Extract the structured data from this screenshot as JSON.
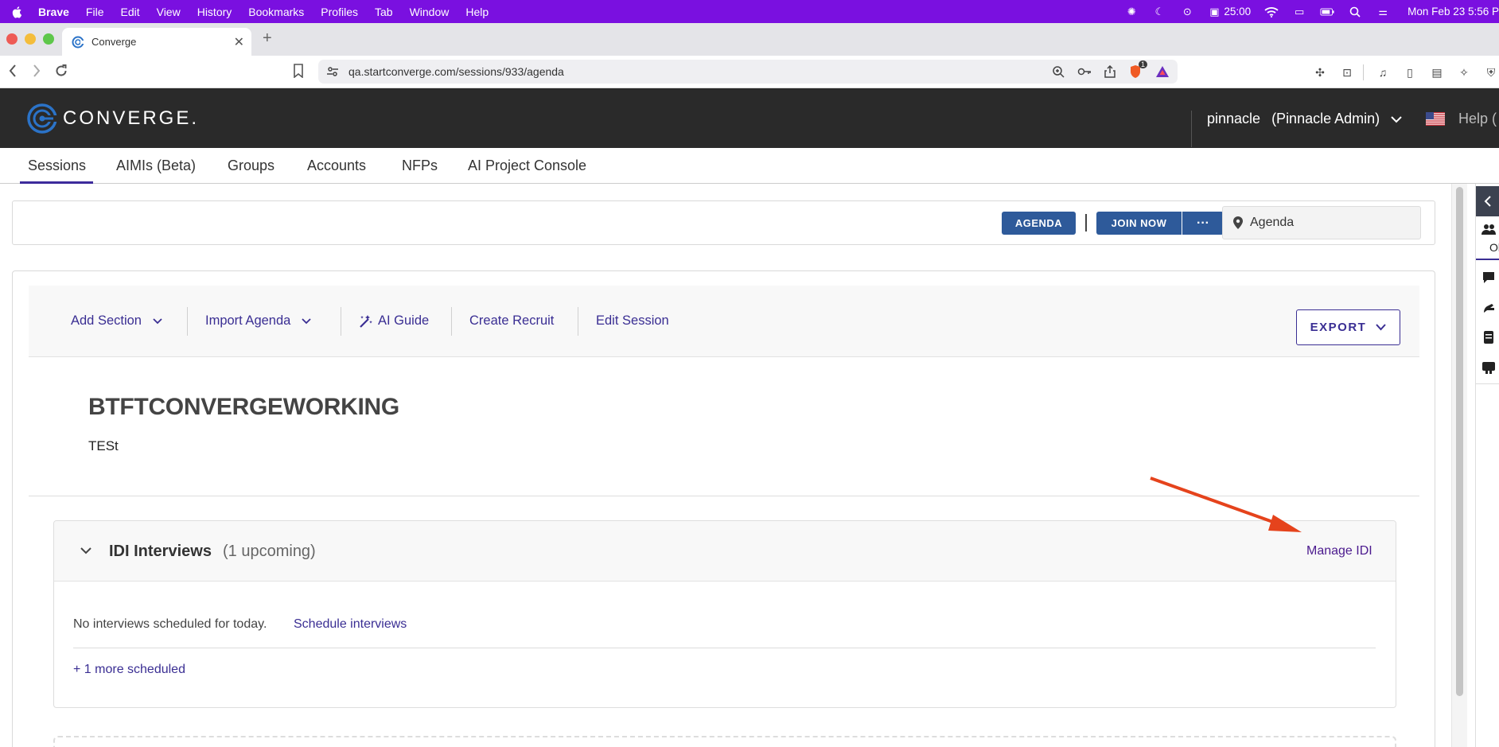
{
  "menubar": {
    "app": "Brave",
    "items": [
      "File",
      "Edit",
      "View",
      "History",
      "Bookmarks",
      "Profiles",
      "Tab",
      "Window",
      "Help"
    ],
    "timer": "25:00",
    "clock": "Mon Feb 23  5:56 P"
  },
  "browser": {
    "tab_title": "Converge",
    "url": "qa.startconverge.com/sessions/933/agenda",
    "brave_badge": "1"
  },
  "header": {
    "logo_text": "CONVERGE.",
    "username": "pinnacle",
    "role": "(Pinnacle Admin)",
    "help": "Help (",
    "colors": {
      "bar": "#2a2a2a"
    }
  },
  "nav": {
    "items": [
      "Sessions",
      "AIMIs (Beta)",
      "Groups",
      "Accounts",
      "NFPs",
      "AI Project Console"
    ],
    "active": "Sessions"
  },
  "session_bar": {
    "agenda_label": "AGENDA",
    "join_label": "JOIN NOW",
    "more_label": "···",
    "location": "Agenda"
  },
  "actions": {
    "add_section": "Add Section",
    "import_agenda": "Import Agenda",
    "ai_guide": "AI Guide",
    "create_recruit": "Create Recruit",
    "edit_session": "Edit Session",
    "export": "EXPORT"
  },
  "session": {
    "title": "BTFTCONVERGEWORKING",
    "description": "TESt"
  },
  "idi": {
    "title": "IDI Interviews",
    "count": "(1 upcoming)",
    "manage": "Manage IDI",
    "empty_text": "No interviews scheduled for today.",
    "schedule_link": "Schedule interviews",
    "more_link": "+ 1 more scheduled"
  },
  "sidebar": {
    "label": "Ol"
  },
  "colors": {
    "accent": "#3a2e93",
    "button": "#2e5a9a",
    "menubar": "#7a10e0",
    "arrow": "#e5431c"
  }
}
